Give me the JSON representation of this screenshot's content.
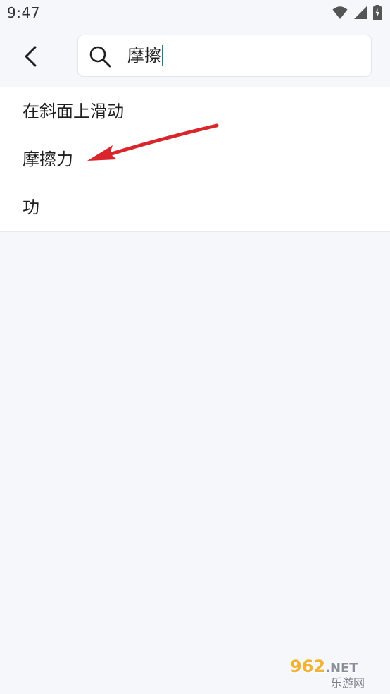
{
  "status_bar": {
    "time": "9:47",
    "icons": [
      "wifi-icon",
      "signal-icon",
      "battery-charging-icon"
    ]
  },
  "header": {
    "back_icon": "chevron-left-icon",
    "search": {
      "icon": "search-icon",
      "value": "摩擦"
    }
  },
  "results": [
    {
      "label": "在斜面上滑动"
    },
    {
      "label": "摩擦力"
    },
    {
      "label": "功"
    }
  ],
  "annotation": {
    "arrow_color": "#d8262c"
  },
  "watermark": {
    "number": "962",
    "domain": ".NET",
    "cn": "乐游网"
  },
  "colors": {
    "background": "#f5f7fb",
    "caret": "#1a7f86",
    "watermark_accent": "#f2b233"
  }
}
